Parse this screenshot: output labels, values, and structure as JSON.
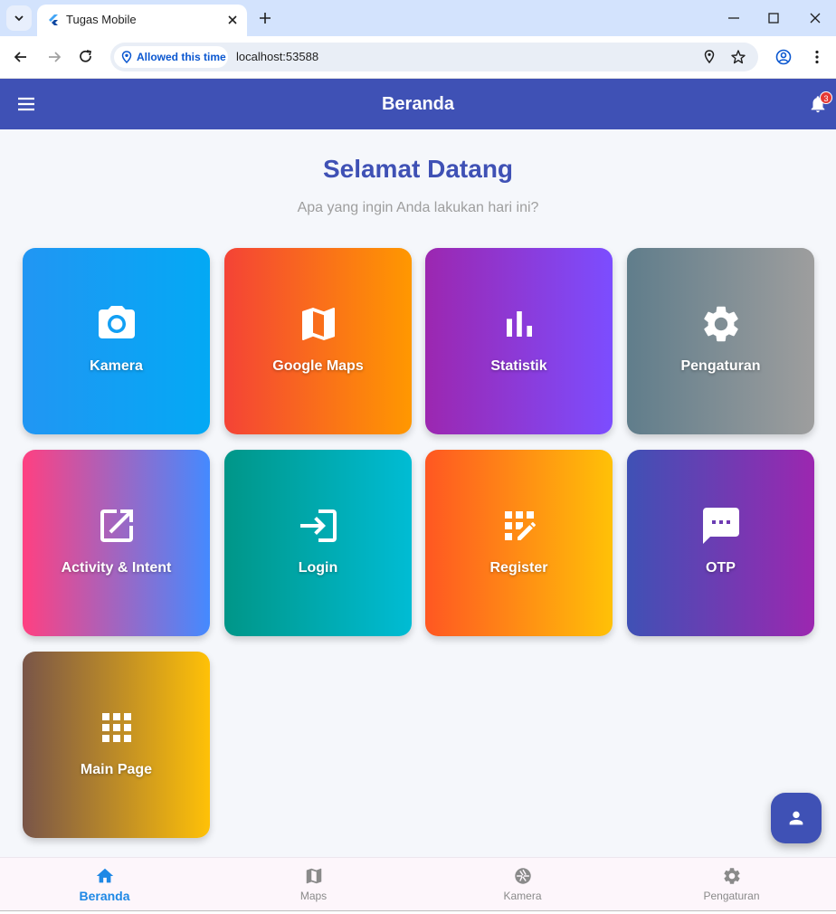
{
  "browser": {
    "tab_title": "Tugas Mobile",
    "permission_chip": "Allowed this time",
    "url": "localhost:53588"
  },
  "appbar": {
    "title": "Beranda",
    "notification_count": "3"
  },
  "main": {
    "heading": "Selamat Datang",
    "subtitle": "Apa yang ingin Anda lakukan hari ini?"
  },
  "cards": [
    {
      "label": "Kamera",
      "icon": "camera-icon",
      "colors": [
        "#2196f3",
        "#03a9f4"
      ]
    },
    {
      "label": "Google Maps",
      "icon": "map-icon",
      "colors": [
        "#f44336",
        "#ff9800"
      ]
    },
    {
      "label": "Statistik",
      "icon": "bar-chart-icon",
      "colors": [
        "#9c27b0",
        "#7c4dff"
      ]
    },
    {
      "label": "Pengaturan",
      "icon": "gear-icon",
      "colors": [
        "#607d8b",
        "#9e9e9e"
      ]
    },
    {
      "label": "Activity & Intent",
      "icon": "open-in-new-icon",
      "colors": [
        "#ff4081",
        "#448aff"
      ]
    },
    {
      "label": "Login",
      "icon": "login-icon",
      "colors": [
        "#009688",
        "#00bcd4"
      ]
    },
    {
      "label": "Register",
      "icon": "app-registration-icon",
      "colors": [
        "#ff5722",
        "#ffc107"
      ]
    },
    {
      "label": "OTP",
      "icon": "sms-icon",
      "colors": [
        "#3f51b5",
        "#9c27b0"
      ]
    },
    {
      "label": "Main Page",
      "icon": "apps-grid-icon",
      "colors": [
        "#795548",
        "#ffc107"
      ]
    }
  ],
  "bottom_nav": [
    {
      "label": "Beranda",
      "icon": "home-icon",
      "active": true
    },
    {
      "label": "Maps",
      "icon": "map-icon",
      "active": false
    },
    {
      "label": "Kamera",
      "icon": "camera-shutter-icon",
      "active": false
    },
    {
      "label": "Pengaturan",
      "icon": "gear-icon",
      "active": false
    }
  ],
  "colors": {
    "primary": "#3f51b5",
    "active_nav": "#1e88e5",
    "browser_frame": "#d3e3fd"
  }
}
